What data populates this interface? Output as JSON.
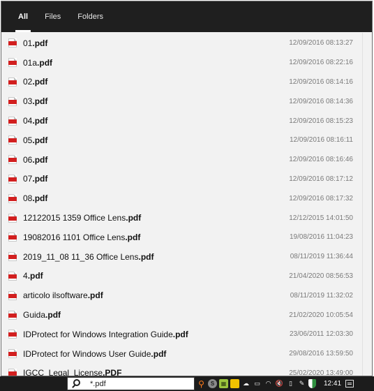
{
  "tabs": [
    {
      "label": "All",
      "active": true
    },
    {
      "label": "Files",
      "active": false
    },
    {
      "label": "Folders",
      "active": false
    }
  ],
  "results": [
    {
      "base": "01",
      "ext": ".pdf",
      "date": "12/09/2016 08:13:27"
    },
    {
      "base": "01a",
      "ext": ".pdf",
      "date": "12/09/2016 08:22:16"
    },
    {
      "base": "02",
      "ext": ".pdf",
      "date": "12/09/2016 08:14:16"
    },
    {
      "base": "03",
      "ext": ".pdf",
      "date": "12/09/2016 08:14:36"
    },
    {
      "base": "04",
      "ext": ".pdf",
      "date": "12/09/2016 08:15:23"
    },
    {
      "base": "05",
      "ext": ".pdf",
      "date": "12/09/2016 08:16:11"
    },
    {
      "base": "06",
      "ext": ".pdf",
      "date": "12/09/2016 08:16:46"
    },
    {
      "base": "07",
      "ext": ".pdf",
      "date": "12/09/2016 08:17:12"
    },
    {
      "base": "08",
      "ext": ".pdf",
      "date": "12/09/2016 08:17:32"
    },
    {
      "base": "12122015 1359 Office Lens",
      "ext": ".pdf",
      "date": "12/12/2015 14:01:50"
    },
    {
      "base": "19082016 1101 Office Lens",
      "ext": ".pdf",
      "date": "19/08/2016 11:04:23"
    },
    {
      "base": "2019_11_08 11_36 Office Lens",
      "ext": ".pdf",
      "date": "08/11/2019 11:36:44"
    },
    {
      "base": "4",
      "ext": ".pdf",
      "date": "21/04/2020 08:56:53"
    },
    {
      "base": "articolo ilsoftware",
      "ext": ".pdf",
      "date": "08/11/2019 11:32:02"
    },
    {
      "base": "Guida",
      "ext": ".pdf",
      "date": "21/02/2020 10:05:54"
    },
    {
      "base": "IDProtect for Windows Integration Guide",
      "ext": ".pdf",
      "date": "23/06/2011 12:03:30"
    },
    {
      "base": "IDProtect for Windows User Guide",
      "ext": ".pdf",
      "date": "29/08/2016 13:59:50"
    },
    {
      "base": "IGCC_Legal_License",
      "ext": ".PDF",
      "date": "25/02/2020 13:49:00"
    }
  ],
  "search": {
    "value": "*.pdf"
  },
  "taskbar": {
    "clock": "12:41",
    "tray_icons": [
      "search-app-icon",
      "skype-icon",
      "green-app-icon",
      "yellow-app-icon",
      "onedrive-icon",
      "battery-icon",
      "wifi-icon",
      "volume-muted-icon",
      "phone-icon",
      "pen-icon",
      "security-shield-icon"
    ],
    "tray_glyphs": {
      "search-app-icon": "⚲",
      "skype-icon": "S",
      "green-app-icon": "▦",
      "yellow-app-icon": "",
      "onedrive-icon": "☁",
      "battery-icon": "▭",
      "wifi-icon": "◠",
      "volume-muted-icon": "🔇",
      "phone-icon": "▯",
      "pen-icon": "✎",
      "security-shield-icon": ""
    }
  }
}
